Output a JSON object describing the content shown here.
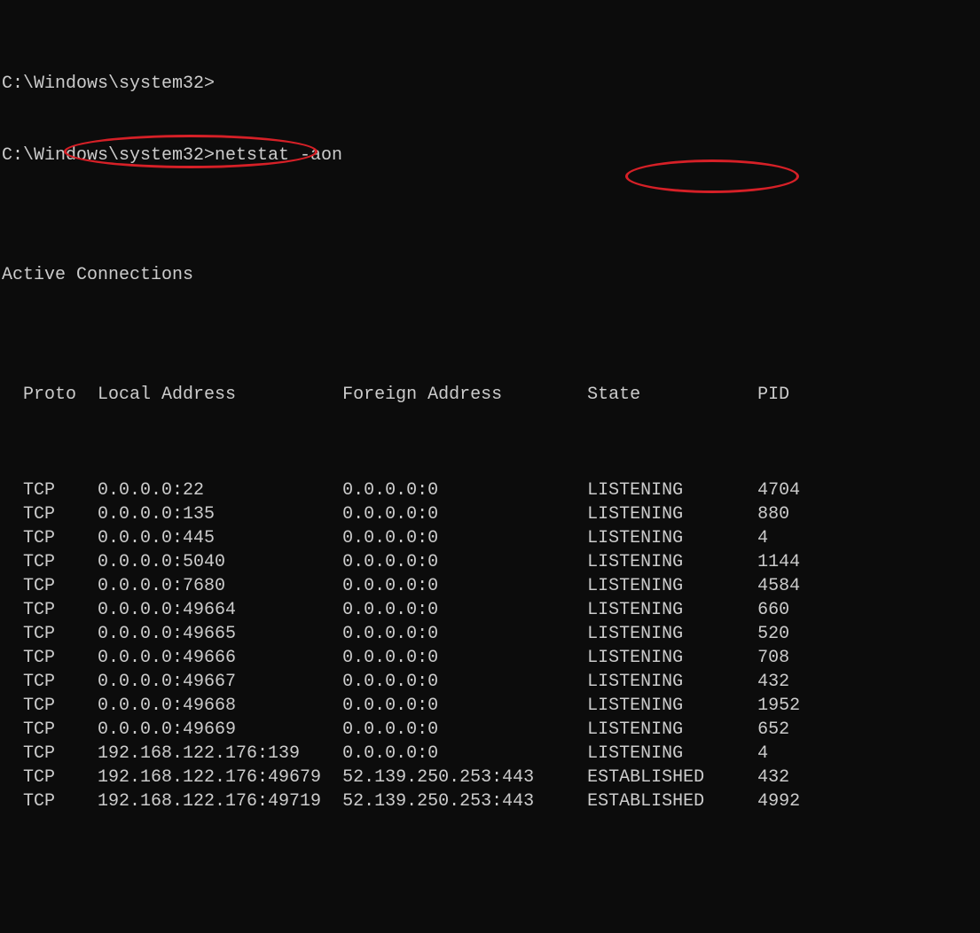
{
  "prompt_lines": [
    "C:\\Windows\\system32>",
    "C:\\Windows\\system32>netstat -aon"
  ],
  "blank_line": "",
  "section_header": "Active Connections",
  "columns_header": "  Proto  Local Address          Foreign Address        State           PID",
  "connections": [
    {
      "proto": "TCP",
      "local": "0.0.0.0:22",
      "foreign": "0.0.0.0:0",
      "state": "LISTENING",
      "pid": "4704"
    },
    {
      "proto": "TCP",
      "local": "0.0.0.0:135",
      "foreign": "0.0.0.0:0",
      "state": "LISTENING",
      "pid": "880"
    },
    {
      "proto": "TCP",
      "local": "0.0.0.0:445",
      "foreign": "0.0.0.0:0",
      "state": "LISTENING",
      "pid": "4"
    },
    {
      "proto": "TCP",
      "local": "0.0.0.0:5040",
      "foreign": "0.0.0.0:0",
      "state": "LISTENING",
      "pid": "1144"
    },
    {
      "proto": "TCP",
      "local": "0.0.0.0:7680",
      "foreign": "0.0.0.0:0",
      "state": "LISTENING",
      "pid": "4584"
    },
    {
      "proto": "TCP",
      "local": "0.0.0.0:49664",
      "foreign": "0.0.0.0:0",
      "state": "LISTENING",
      "pid": "660"
    },
    {
      "proto": "TCP",
      "local": "0.0.0.0:49665",
      "foreign": "0.0.0.0:0",
      "state": "LISTENING",
      "pid": "520"
    },
    {
      "proto": "TCP",
      "local": "0.0.0.0:49666",
      "foreign": "0.0.0.0:0",
      "state": "LISTENING",
      "pid": "708"
    },
    {
      "proto": "TCP",
      "local": "0.0.0.0:49667",
      "foreign": "0.0.0.0:0",
      "state": "LISTENING",
      "pid": "432"
    },
    {
      "proto": "TCP",
      "local": "0.0.0.0:49668",
      "foreign": "0.0.0.0:0",
      "state": "LISTENING",
      "pid": "1952"
    },
    {
      "proto": "TCP",
      "local": "0.0.0.0:49669",
      "foreign": "0.0.0.0:0",
      "state": "LISTENING",
      "pid": "652"
    },
    {
      "proto": "TCP",
      "local": "192.168.122.176:139",
      "foreign": "0.0.0.0:0",
      "state": "LISTENING",
      "pid": "4"
    },
    {
      "proto": "TCP",
      "local": "192.168.122.176:49679",
      "foreign": "52.139.250.253:443",
      "state": "ESTABLISHED",
      "pid": "432"
    },
    {
      "proto": "TCP",
      "local": "192.168.122.176:49719",
      "foreign": "52.139.250.253:443",
      "state": "ESTABLISHED",
      "pid": "4992"
    }
  ],
  "col_widths": {
    "indent": 2,
    "proto": 7,
    "local": 23,
    "foreign": 23,
    "state": 16
  }
}
